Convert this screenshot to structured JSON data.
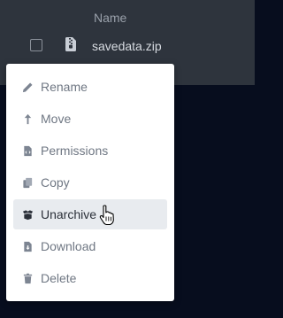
{
  "file_list": {
    "column_header": "Name",
    "rows": [
      {
        "name": "savedata.zip",
        "icon": "file-zip-icon"
      }
    ]
  },
  "context_menu": {
    "items": [
      {
        "label": "Rename",
        "icon": "pencil-icon"
      },
      {
        "label": "Move",
        "icon": "arrow-up-icon"
      },
      {
        "label": "Permissions",
        "icon": "file-code-icon"
      },
      {
        "label": "Copy",
        "icon": "copy-icon"
      },
      {
        "label": "Unarchive",
        "icon": "box-open-icon",
        "hovered": true
      },
      {
        "label": "Download",
        "icon": "file-download-icon"
      },
      {
        "label": "Delete",
        "icon": "trash-icon"
      }
    ]
  },
  "colors": {
    "page_background": "#070d1e",
    "panel_background": "#2e343d",
    "menu_background": "#ffffff",
    "hover_background": "#e8ebef",
    "menu_text": "#6f7783"
  }
}
